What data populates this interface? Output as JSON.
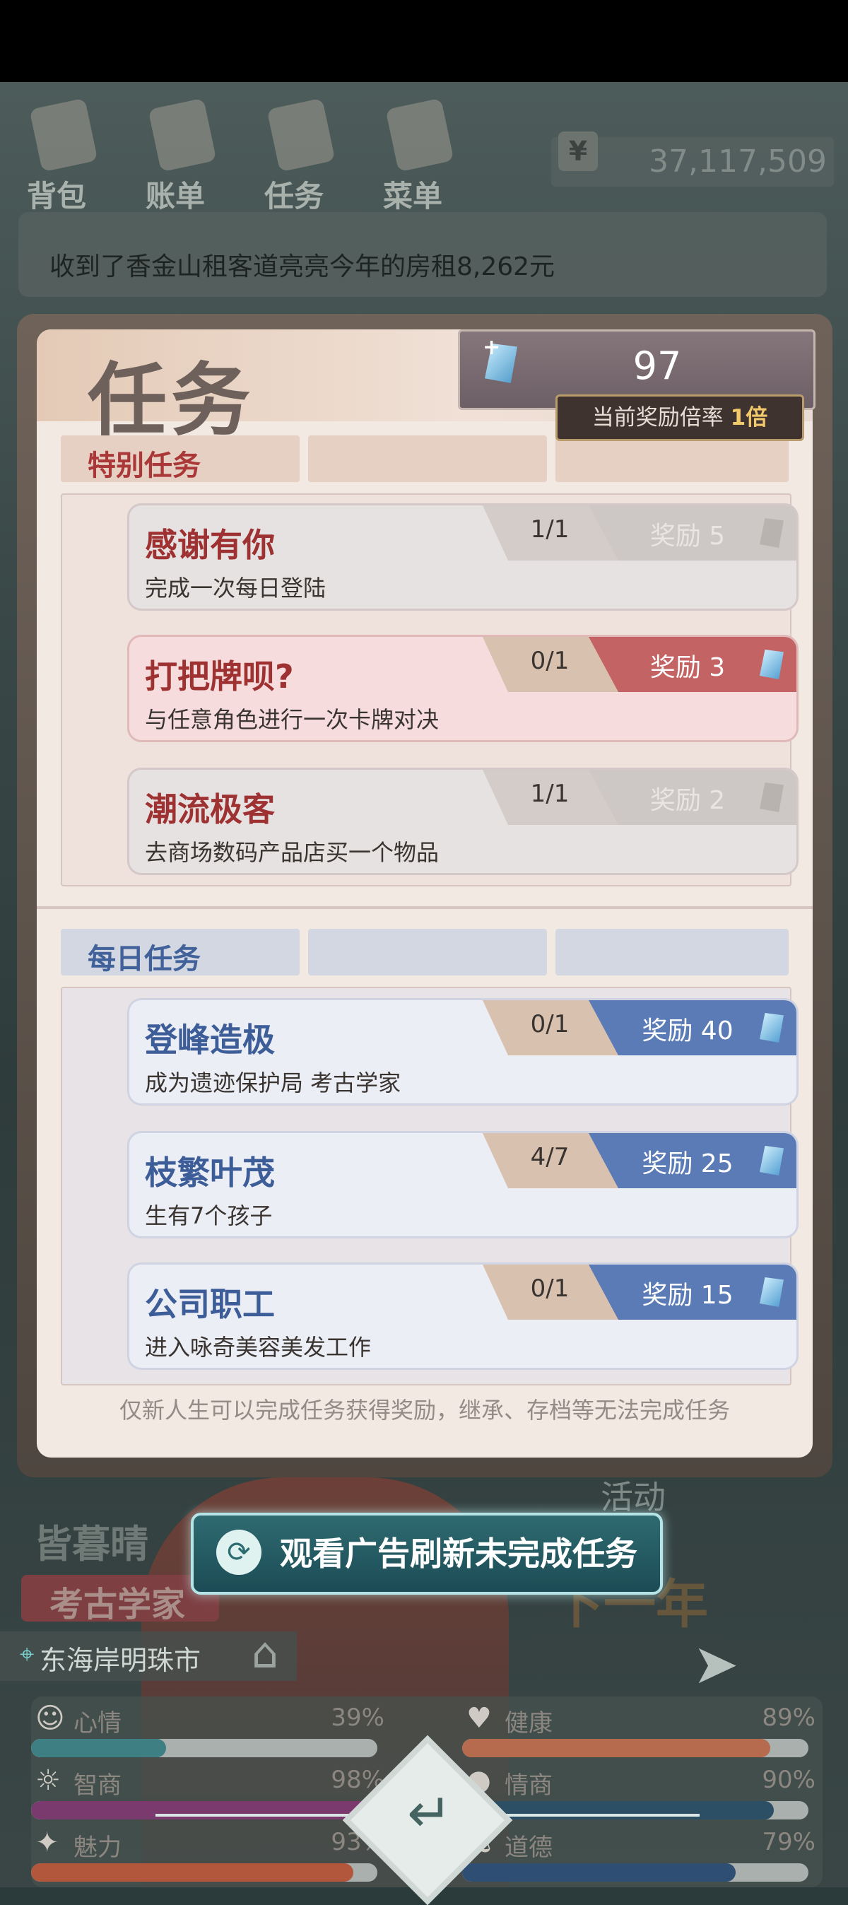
{
  "topbar": {
    "nav": [
      {
        "label": "背包",
        "icon": "backpack-icon"
      },
      {
        "label": "账单",
        "icon": "bill-icon"
      },
      {
        "label": "任务",
        "icon": "task-icon"
      },
      {
        "label": "菜单",
        "icon": "menu-icon"
      }
    ],
    "money_symbol": "¥",
    "money": "37,117,509"
  },
  "notice": "收到了香金山租客道亮亮今年的房租8,262元",
  "panel": {
    "title": "任务",
    "gem_count": "97",
    "multiplier_label": "当前奖励倍率",
    "multiplier_value": "1倍"
  },
  "special": {
    "section_label": "特别任务",
    "tasks": [
      {
        "title": "感谢有你",
        "desc": "完成一次每日登陆",
        "progress": "1/1",
        "reward": "奖励 5",
        "state": "done"
      },
      {
        "title": "打把牌呗?",
        "desc": "与任意角色进行一次卡牌对决",
        "progress": "0/1",
        "reward": "奖励 3",
        "state": "active"
      },
      {
        "title": "潮流极客",
        "desc": "去商场数码产品店买一个物品",
        "progress": "1/1",
        "reward": "奖励 2",
        "state": "done"
      }
    ]
  },
  "daily": {
    "section_label": "每日任务",
    "tasks": [
      {
        "title": "登峰造极",
        "desc": "成为遗迹保护局 考古学家",
        "progress": "0/1",
        "reward": "奖励 40"
      },
      {
        "title": "枝繁叶茂",
        "desc": "生有7个孩子",
        "progress": "4/7",
        "reward": "奖励 25"
      },
      {
        "title": "公司职工",
        "desc": "进入咏奇美容美发工作",
        "progress": "0/1",
        "reward": "奖励 15"
      }
    ]
  },
  "footnote": "仅新人生可以完成任务获得奖励，继承、存档等无法完成任务",
  "ad_button": "观看广告刷新未完成任务",
  "background": {
    "character_name": "皆暮晴",
    "job": "考古学家",
    "location": "东海岸明珠市",
    "next_year": "下一年",
    "activity": "活动"
  },
  "stats": [
    {
      "name": "心情",
      "value": "39%",
      "fraction": 0.39,
      "color": "#3e7f83",
      "icon": "smile-icon"
    },
    {
      "name": "健康",
      "value": "89%",
      "fraction": 0.89,
      "color": "#b66a4e",
      "icon": "heart-icon"
    },
    {
      "name": "智商",
      "value": "98%",
      "fraction": 0.98,
      "color": "#7a3a6d",
      "icon": "bulb-icon"
    },
    {
      "name": "情商",
      "value": "90%",
      "fraction": 0.9,
      "color": "#2c4f66",
      "icon": "apple-icon"
    },
    {
      "name": "魅力",
      "value": "93%",
      "fraction": 0.93,
      "color": "#b2573c",
      "icon": "sparkle-icon"
    },
    {
      "name": "道德",
      "value": "79%",
      "fraction": 0.79,
      "color": "#2f4e73",
      "icon": "scale-icon"
    }
  ]
}
